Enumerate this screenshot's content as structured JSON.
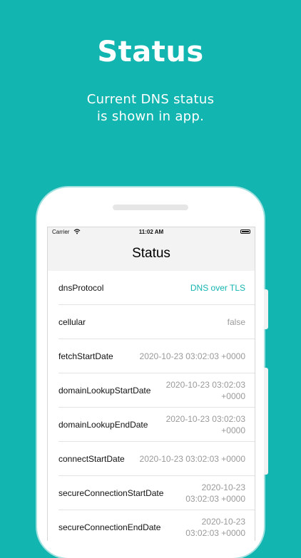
{
  "promo": {
    "title": "Status",
    "subtitle_line1": "Current DNS status",
    "subtitle_line2": "is shown in app."
  },
  "statusbar": {
    "carrier": "Carrier",
    "time": "11:02 AM"
  },
  "screen": {
    "title": "Status",
    "rows": [
      {
        "key": "dnsProtocol",
        "value": "DNS over TLS"
      },
      {
        "key": "cellular",
        "value": "false"
      },
      {
        "key": "fetchStartDate",
        "value": "2020-10-23 03:02:03 +0000"
      },
      {
        "key": "domainLookupStartDate",
        "value_line1": "2020-10-23 03:02:03",
        "value_line2": "+0000"
      },
      {
        "key": "domainLookupEndDate",
        "value_line1": "2020-10-23 03:02:03",
        "value_line2": "+0000"
      },
      {
        "key": "connectStartDate",
        "value": "2020-10-23 03:02:03 +0000"
      },
      {
        "key": "secureConnectionStartDate",
        "value_line1": "2020-10-23",
        "value_line2": "03:02:03 +0000"
      },
      {
        "key": "secureConnectionEndDate",
        "value_line1": "2020-10-23",
        "value_line2": "03:02:03 +0000"
      }
    ]
  },
  "colors": {
    "background": "#13b5b1",
    "accent": "#13b5b1"
  }
}
